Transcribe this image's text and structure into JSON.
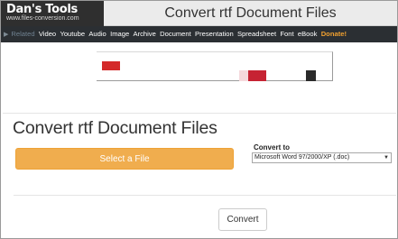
{
  "header": {
    "logo_title": "Dan's Tools",
    "logo_subtitle": "www.files-conversion.com",
    "title": "Convert rtf Document Files"
  },
  "nav": {
    "items": [
      {
        "label": "Related",
        "muted": true
      },
      {
        "label": "Video"
      },
      {
        "label": "Youtube"
      },
      {
        "label": "Audio"
      },
      {
        "label": "Image"
      },
      {
        "label": "Archive"
      },
      {
        "label": "Document"
      },
      {
        "label": "Presentation"
      },
      {
        "label": "Spreadsheet"
      },
      {
        "label": "Font"
      },
      {
        "label": "eBook"
      },
      {
        "label": "Donate!",
        "donate": true
      }
    ]
  },
  "ad": {
    "blocks": [
      {
        "color": "#d42a2a"
      },
      {
        "color": "#f5d9dc"
      },
      {
        "color": "#c62333"
      },
      {
        "color": "#2a2a2a"
      }
    ]
  },
  "main": {
    "title": "Convert rtf Document Files",
    "select_file_label": "Select a File",
    "convert_to_label": "Convert to",
    "format_selected": "Microsoft Word 97/2000/XP (.doc)",
    "convert_button": "Convert"
  },
  "colors": {
    "accent_orange": "#f0ad4e",
    "nav_bg": "#2b2f33",
    "donate": "#f0a030"
  }
}
